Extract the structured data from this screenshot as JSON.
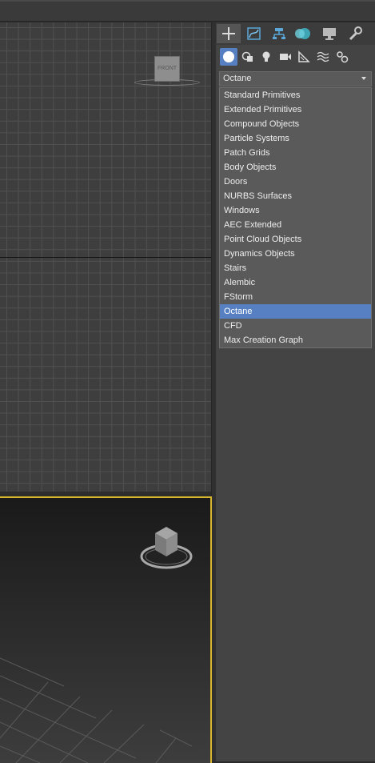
{
  "command_panel": {
    "tabs": [
      {
        "icon": "create-plus-icon",
        "active": true
      },
      {
        "icon": "modify-curve-icon",
        "active": false
      },
      {
        "icon": "hierarchy-icon",
        "active": false
      },
      {
        "icon": "motion-icon",
        "active": false
      },
      {
        "icon": "display-monitor-icon",
        "active": false
      },
      {
        "icon": "utilities-wrench-icon",
        "active": false
      }
    ],
    "subtabs": [
      {
        "icon": "geometry-sphere-icon",
        "active": true
      },
      {
        "icon": "shapes-icon",
        "active": false
      },
      {
        "icon": "lights-bulb-icon",
        "active": false
      },
      {
        "icon": "cameras-icon",
        "active": false
      },
      {
        "icon": "helpers-icon",
        "active": false
      },
      {
        "icon": "space-warps-icon",
        "active": false
      },
      {
        "icon": "systems-gears-icon",
        "active": false
      }
    ],
    "dropdown": {
      "selected": "Octane",
      "options": [
        "Standard Primitives",
        "Extended Primitives",
        "Compound Objects",
        "Particle Systems",
        "Patch Grids",
        "Body Objects",
        "Doors",
        "NURBS Surfaces",
        "Windows",
        "AEC Extended",
        "Point Cloud Objects",
        "Dynamics Objects",
        "Stairs",
        "Alembic",
        "FStorm",
        "Octane",
        "CFD",
        "Max Creation Graph"
      ]
    }
  },
  "viewports": {
    "top": {
      "viewcube_label": "FRONT"
    }
  },
  "colors": {
    "accent_selection": "#5680c2",
    "active_viewport_border": "#d7b62e"
  }
}
